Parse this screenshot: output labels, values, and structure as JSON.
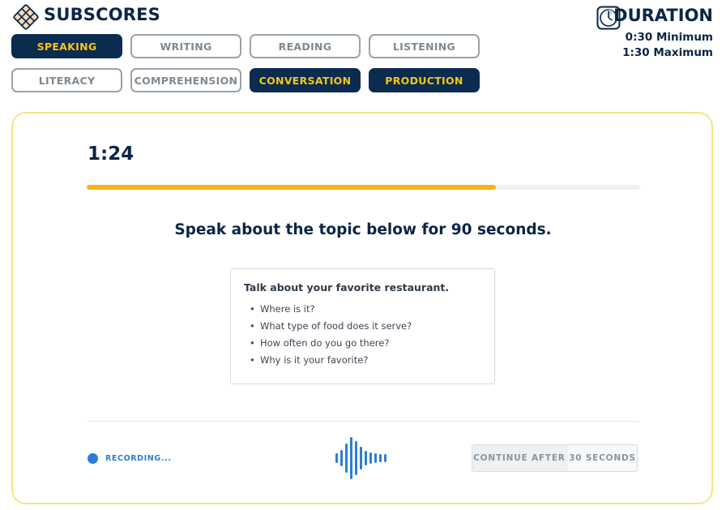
{
  "header": {
    "subscores_title": "SUBSCORES",
    "duration_title": "DURATION",
    "duration_minimum": "0:30 Minimum",
    "duration_maximum": "1:30 Maximum"
  },
  "subscore_tabs": [
    {
      "label": "SPEAKING",
      "active": true
    },
    {
      "label": "WRITING",
      "active": false
    },
    {
      "label": "READING",
      "active": false
    },
    {
      "label": "LISTENING",
      "active": false
    },
    {
      "label": "LITERACY",
      "active": false
    },
    {
      "label": "COMPREHENSION",
      "active": false
    },
    {
      "label": "CONVERSATION",
      "active": true
    },
    {
      "label": "PRODUCTION",
      "active": true
    }
  ],
  "task": {
    "timer": "1:24",
    "progress_fraction": 0.74,
    "instruction": "Speak about the topic below for 90 seconds.",
    "topic_heading": "Talk about your favorite restaurant.",
    "topic_bullets": [
      "Where is it?",
      "What type of food does it serve?",
      "How often do you go there?",
      "Why is it your favorite?"
    ]
  },
  "footer": {
    "recording_label": "RECORDING...",
    "continue_label": "CONTINUE AFTER 30 SECONDS"
  },
  "colors": {
    "navy": "#0b2b4f",
    "accent_yellow": "#f5c518",
    "progress_orange": "#f7b315",
    "recording_blue": "#2a7fd4",
    "card_border": "#f3e48a"
  },
  "icons": {
    "logo": "diamond-grid-icon",
    "duration": "clock-icon",
    "recording": "recording-dot-icon",
    "waveform": "audio-waveform-icon"
  }
}
